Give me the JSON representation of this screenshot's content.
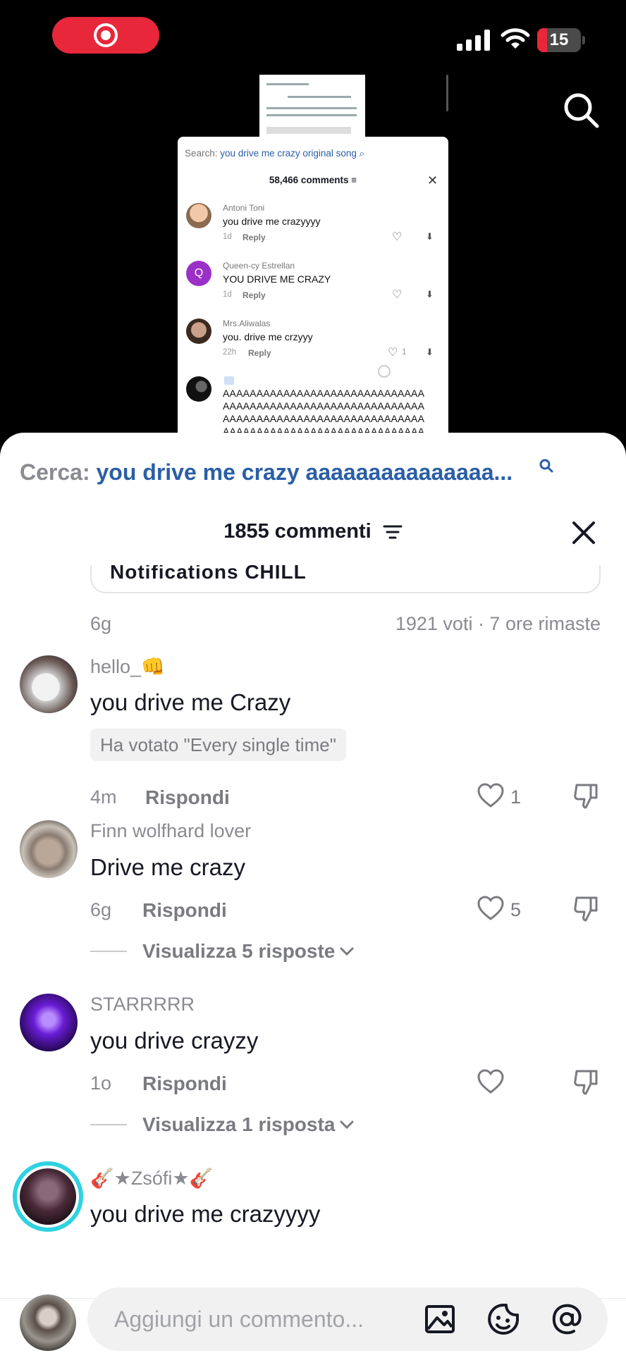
{
  "status_bar": {
    "battery": "15"
  },
  "embedded_screenshot": {
    "search_label": "Search:",
    "search_query": "you drive me crazy original song",
    "comment_count": "58,466 comments",
    "comments": [
      {
        "user": "Antoni Toni",
        "text": "you drive me crazyyyy",
        "time": "1d",
        "reply": "Reply",
        "likes": ""
      },
      {
        "user": "Queen-cy Estrellan",
        "text": "YOU DRIVE ME CRAZY",
        "time": "1d",
        "reply": "Reply",
        "likes": ""
      },
      {
        "user": "Mrs.Aliwalas",
        "text": "you. drive me crzyyy",
        "time": "22h",
        "reply": "Reply",
        "likes": "1"
      }
    ],
    "spam_lines": [
      "AAAAAAAAAAAAAAAAAAAAAAAAAAAAAA",
      "AAAAAAAAAAAAAAAAAAAAAAAAAAAAAA",
      "AAAAAAAAAAAAAAAAAAAAAAAAAAAAAA",
      "AAAAAAAAAAAAAAAAAAAAAAAAAAAAAA"
    ]
  },
  "sheet": {
    "search_label": "Cerca:",
    "search_query": "you drive me crazy aaaaaaaaaaaaaaa...",
    "comment_count": "1855 commenti",
    "poll": {
      "option_text": "Notifications CHILL",
      "age": "6g",
      "votes_info": "1921 voti · 7 ore rimaste"
    },
    "comments": [
      {
        "user": "hello_👊",
        "text": "you drive me Crazy",
        "vote_tag": "Ha votato \"Every single time\"",
        "time": "4m",
        "reply": "Rispondi",
        "likes": "1",
        "view_replies": ""
      },
      {
        "user": "Finn wolfhard lover",
        "text": "Drive me crazy",
        "vote_tag": "",
        "time": "6g",
        "reply": "Rispondi",
        "likes": "5",
        "view_replies": "Visualizza 5 risposte"
      },
      {
        "user": "STARRRRR",
        "text": "you drive crayzy",
        "vote_tag": "",
        "time": "1o",
        "reply": "Rispondi",
        "likes": "",
        "view_replies": "Visualizza 1 risposta"
      },
      {
        "user": "🎸★Zsófi★🎸",
        "text": "you drive me crazyyyy",
        "vote_tag": "",
        "time": "",
        "reply": "",
        "likes": "",
        "view_replies": ""
      }
    ],
    "input_placeholder": "Aggiungi un commento..."
  },
  "colors": {
    "accent_link": "#2b5ea6",
    "record_red": "#e8273b",
    "muted_text": "#8a8b91"
  },
  "icons": [
    "record-icon",
    "signal-icon",
    "wifi-icon",
    "battery-icon",
    "search-icon",
    "filter-icon",
    "close-icon",
    "heart-icon",
    "dislike-icon",
    "chevron-down-icon",
    "image-icon",
    "emoji-icon",
    "mention-icon"
  ]
}
